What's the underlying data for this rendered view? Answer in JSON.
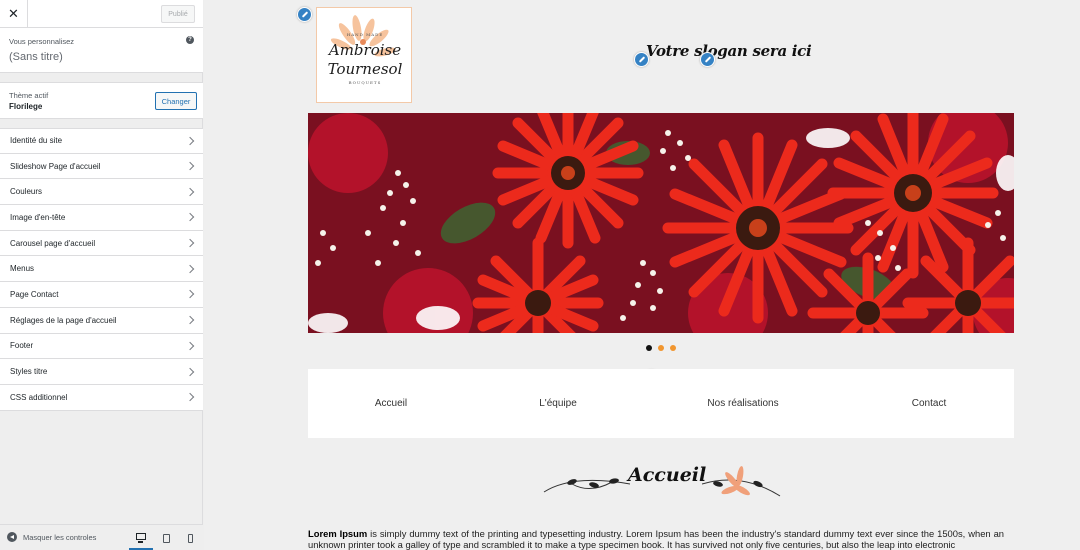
{
  "sidebar": {
    "close_label": "✕",
    "publish_label": "Publié",
    "customizing_label": "Vous personnalisez",
    "site_title": "(Sans titre)",
    "help_label": "?",
    "active_theme_label": "Thème actif",
    "theme_name": "Florilege",
    "change_label": "Changer",
    "items": [
      {
        "label": "Identité du site"
      },
      {
        "label": "Slideshow Page d'accueil"
      },
      {
        "label": "Couleurs"
      },
      {
        "label": "Image d'en-tête"
      },
      {
        "label": "Carousel page d'accueil"
      },
      {
        "label": "Menus"
      },
      {
        "label": "Page Contact"
      },
      {
        "label": "Réglages de la page d'accueil"
      },
      {
        "label": "Footer"
      },
      {
        "label": "Styles titre"
      },
      {
        "label": "CSS additionnel"
      }
    ],
    "hide_controls_label": "Masquer les controles",
    "devices": [
      "desktop-icon",
      "tablet-icon",
      "mobile-icon"
    ]
  },
  "preview": {
    "logo": {
      "top_text": "HAND MADE",
      "line1": "Ambroise",
      "line2": "Tournesol",
      "bottom_text": "BOUQUETS"
    },
    "slogan": "Votre slogan sera ici",
    "slider": {
      "slides": 3,
      "active_slide": 1
    },
    "nav": [
      "Accueil",
      "L'équipe",
      "Nos réalisations",
      "Contact"
    ],
    "section_title": "Accueil",
    "lorem_bold": "Lorem Ipsum",
    "lorem_text": " is simply dummy text of the printing and typesetting industry. Lorem Ipsum has been the industry's standard dummy text ever since the 1500s, when an unknown printer took a galley of type and scrambled it to make a type specimen book. It has survived not only five centuries, but also the leap into electronic",
    "colors": {
      "accent_orange": "#f1962f",
      "edit_blue": "#3582c4",
      "admin_blue": "#2271b1",
      "flower_red": "#e5281e"
    }
  }
}
